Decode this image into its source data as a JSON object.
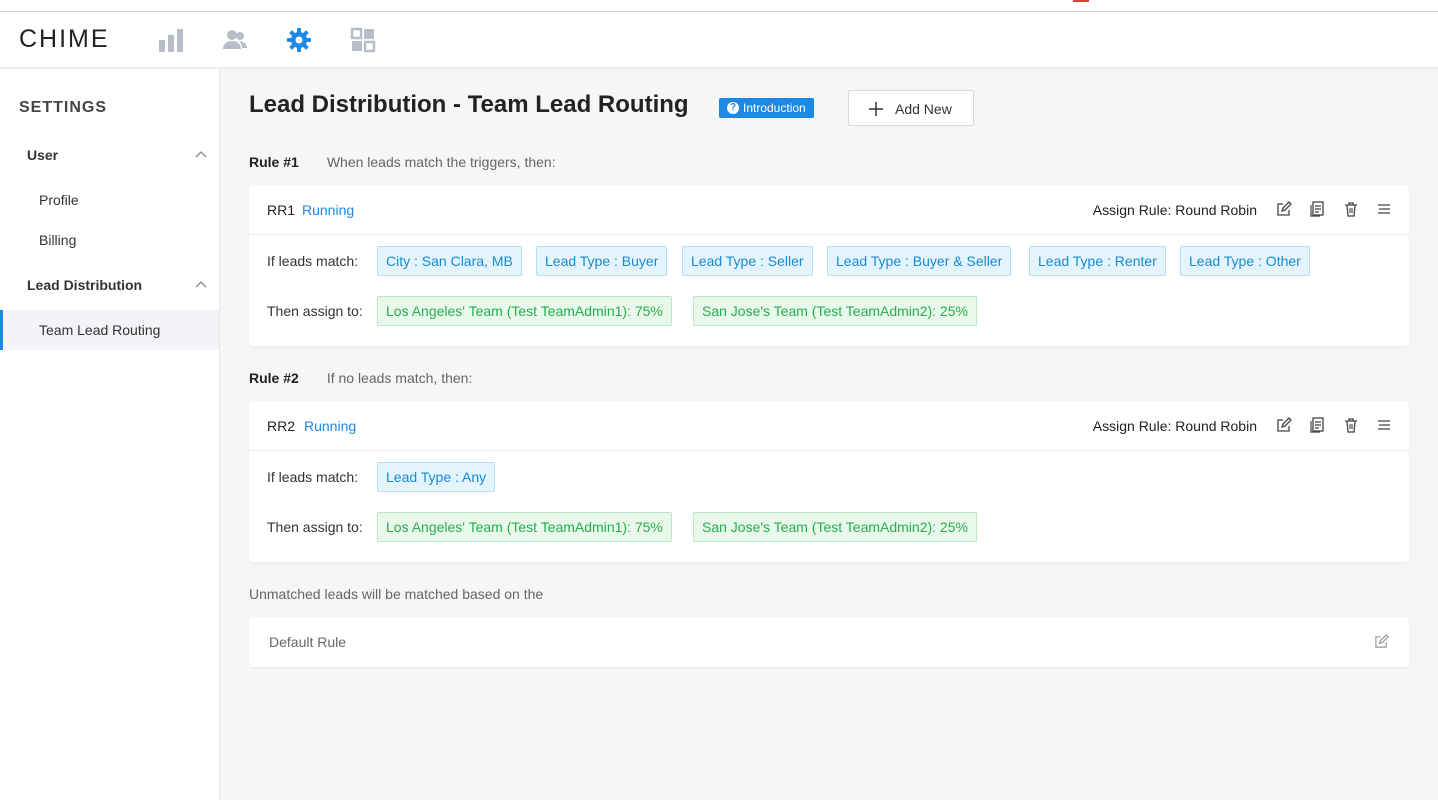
{
  "app": {
    "logo_text": "CHIME",
    "nav": [
      {
        "name": "analytics-icon",
        "active": false
      },
      {
        "name": "people-icon",
        "active": false
      },
      {
        "name": "settings-gear-icon",
        "active": true
      },
      {
        "name": "dashboard-grid-icon",
        "active": false
      }
    ],
    "accent_color": "#1e88e5"
  },
  "sidebar": {
    "title": "SETTINGS",
    "groups": [
      {
        "label": "User",
        "items": [
          "Profile",
          "Billing"
        ]
      },
      {
        "label": "Lead Distribution",
        "items": [
          "Team Lead Routing"
        ]
      }
    ],
    "active_item": "Team Lead Routing"
  },
  "main": {
    "title": "Lead Distribution - Team Lead Routing",
    "intro_label": "Introduction",
    "add_label": "Add New",
    "rules": [
      {
        "number": "Rule #1",
        "description": "When leads match the triggers, then:",
        "name": "RR1",
        "status": "Running",
        "assign_rule": "Assign Rule: Round Robin",
        "match_label": "If leads match:",
        "triggers": [
          "City : San Clara, MB",
          "Lead Type : Buyer",
          "Lead Type : Seller",
          "Lead Type : Buyer & Seller",
          "Lead Type : Renter",
          "Lead Type : Other"
        ],
        "assign_label": "Then assign to:",
        "assignees": [
          "Los Angeles' Team (Test TeamAdmin1): 75%",
          "San Jose's Team (Test TeamAdmin2): 25%"
        ]
      },
      {
        "number": "Rule #2",
        "description": "If no leads match, then:",
        "name": "RR2",
        "status": "Running",
        "assign_rule": "Assign Rule: Round Robin",
        "match_label": "If leads match:",
        "triggers": [
          "Lead Type : Any"
        ],
        "assign_label": "Then assign to:",
        "assignees": [
          "Los Angeles' Team (Test TeamAdmin1): 75%",
          "San Jose's Team (Test TeamAdmin2): 25%"
        ]
      }
    ],
    "unmatched_text": "Unmatched leads will be matched based on the",
    "default_rule": "Default Rule"
  }
}
